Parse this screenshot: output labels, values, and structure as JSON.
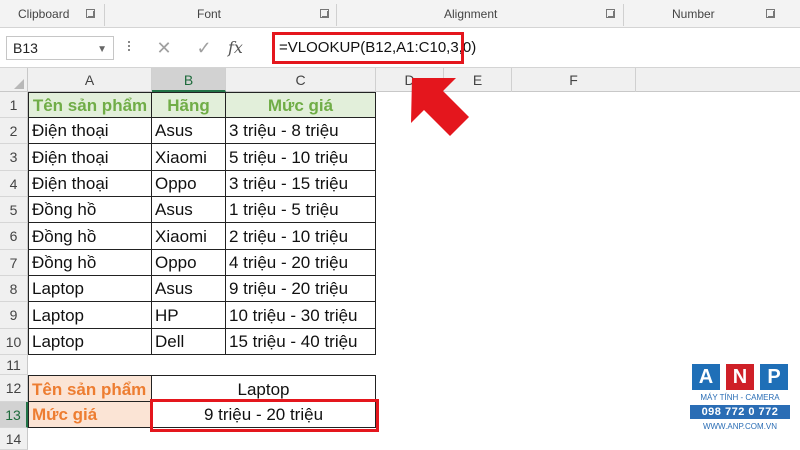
{
  "ribbon": {
    "groups": [
      {
        "label": "Clipboard"
      },
      {
        "label": "Font"
      },
      {
        "label": "Alignment"
      },
      {
        "label": "Number"
      }
    ]
  },
  "formula_bar": {
    "name_box": "B13",
    "cancel_icon": "close-icon",
    "enter_icon": "check-icon",
    "fx_label": "fx",
    "formula": "=VLOOKUP(B12,A1:C10,3,0)",
    "highlight_color": "#e4161d"
  },
  "grid": {
    "columns": [
      "A",
      "B",
      "C",
      "D",
      "E",
      "F"
    ],
    "selected_column": "B",
    "rows": [
      "1",
      "2",
      "3",
      "4",
      "5",
      "6",
      "7",
      "8",
      "9",
      "10",
      "11",
      "12",
      "13",
      "14"
    ],
    "selected_row": "13",
    "header_row": [
      "Tên sản phẩm",
      "Hãng",
      "Mức giá"
    ],
    "data": [
      [
        "Điện thoại",
        "Asus",
        "3 triệu - 8 triệu"
      ],
      [
        "Điện thoại",
        "Xiaomi",
        "5 triệu - 10 triệu"
      ],
      [
        "Điện thoại",
        "Oppo",
        "3 triệu - 15 triệu"
      ],
      [
        "Đồng hồ",
        "Asus",
        "1 triệu - 5 triệu"
      ],
      [
        "Đồng hồ",
        "Xiaomi",
        "2 triệu - 10 triệu"
      ],
      [
        "Đồng hồ",
        "Oppo",
        "4 triệu - 20 triệu"
      ],
      [
        "Laptop",
        "Asus",
        "9 triệu - 20 triệu"
      ],
      [
        "Laptop",
        "HP",
        "10 triệu - 30 triệu"
      ],
      [
        "Laptop",
        "Dell",
        "15 triệu - 40 triệu"
      ]
    ],
    "lookup": {
      "label_product": "Tên sản phẩm",
      "value_product": "Laptop",
      "label_price": "Mức giá",
      "value_price": "9 triệu - 20 triệu"
    },
    "colors": {
      "header_fill": "#e2efda",
      "header_text": "#70ad47",
      "label_fill": "#fbe4d5",
      "label_text": "#ed7d31"
    }
  },
  "watermark": {
    "letters": [
      "A",
      "N",
      "P"
    ],
    "subtitle": "MÁY TÍNH - CAMERA",
    "phone": "098 772 0 772",
    "site": "WWW.ANP.COM.VN"
  }
}
